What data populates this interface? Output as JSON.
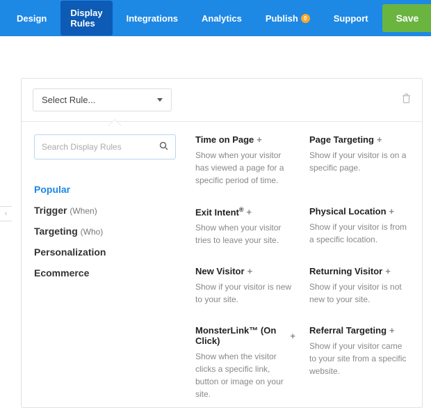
{
  "nav": {
    "design": "Design",
    "display_rules": "Display Rules",
    "integrations": "Integrations",
    "analytics": "Analytics",
    "publish": "Publish",
    "publish_badge": "0",
    "support": "Support",
    "save": "Save"
  },
  "select_rule": {
    "label": "Select Rule..."
  },
  "search": {
    "placeholder": "Search Display Rules"
  },
  "categories": {
    "popular": "Popular",
    "trigger": "Trigger",
    "trigger_sub": "(When)",
    "targeting": "Targeting",
    "targeting_sub": "(Who)",
    "personalization": "Personalization",
    "ecommerce": "Ecommerce"
  },
  "rules": {
    "time_on_page": {
      "title": "Time on Page",
      "desc": "Show when your visitor has viewed a page for a specific period of time."
    },
    "page_targeting": {
      "title": "Page Targeting",
      "desc": "Show if your visitor is on a specific page."
    },
    "exit_intent": {
      "title": "Exit Intent",
      "desc": "Show when your visitor tries to leave your site."
    },
    "physical_location": {
      "title": "Physical Location",
      "desc": "Show if your visitor is from a specific location."
    },
    "new_visitor": {
      "title": "New Visitor",
      "desc": "Show if your visitor is new to your site."
    },
    "returning_visitor": {
      "title": "Returning Visitor",
      "desc": "Show if your visitor is not new to your site."
    },
    "monsterlink": {
      "title": "MonsterLink™ (On Click)",
      "desc": "Show when the visitor clicks a specific link, button or image on your site."
    },
    "referral_targeting": {
      "title": "Referral Targeting",
      "desc": "Show if your visitor came to your site from a specific website."
    }
  }
}
